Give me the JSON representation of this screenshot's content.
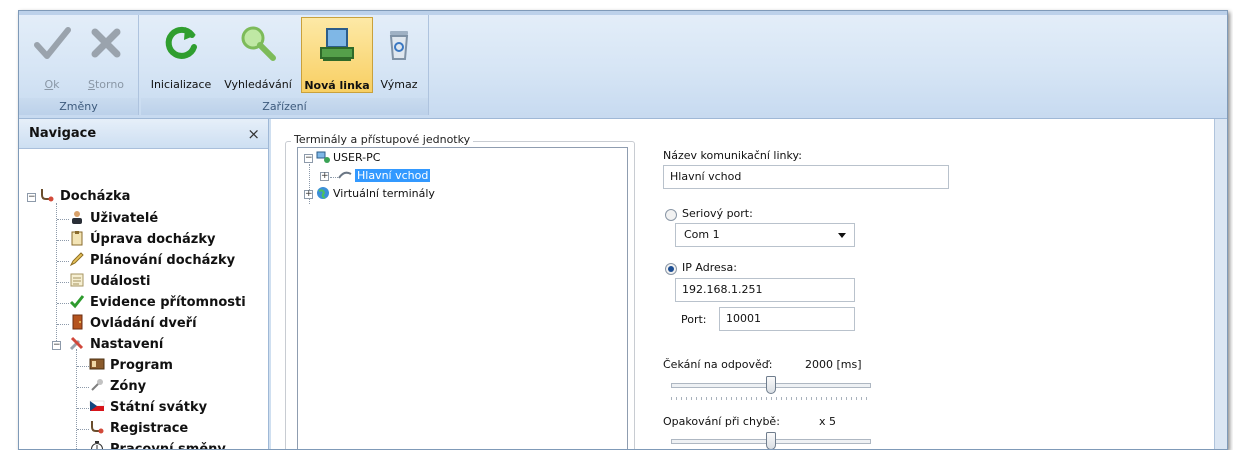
{
  "ribbon": {
    "groups": [
      {
        "caption": "Změny"
      },
      {
        "caption": "Zařízení"
      }
    ],
    "buttons": {
      "ok": {
        "prefix": "O",
        "rest": "k"
      },
      "storno": {
        "prefix": "S",
        "rest": "torno"
      },
      "inicializace": "Inicializace",
      "vyhledavani": "Vyhledávání",
      "nova_linka": "Nová linka",
      "vymaz": "Výmaz"
    }
  },
  "navigation": {
    "title": "Navigace",
    "close": "×",
    "items": [
      {
        "label": "Docházka"
      },
      {
        "label": "Uživatelé"
      },
      {
        "label": "Úprava docházky"
      },
      {
        "label": "Plánování docházky"
      },
      {
        "label": "Události"
      },
      {
        "label": "Evidence přítomnosti"
      },
      {
        "label": "Ovládání dveří"
      },
      {
        "label": "Nastavení"
      },
      {
        "label": "Program"
      },
      {
        "label": "Zóny"
      },
      {
        "label": "Státní svátky"
      },
      {
        "label": "Registrace"
      },
      {
        "label": "Pracovní směny"
      }
    ]
  },
  "terminals": {
    "legend": "Terminály a přístupové jednotky",
    "tree": [
      {
        "label": "USER-PC"
      },
      {
        "label": "Hlavní vchod"
      },
      {
        "label": "Virtuální terminály"
      }
    ]
  },
  "form": {
    "name_label": "Název komunikační linky:",
    "name_value": "Hlavní vchod",
    "serial_label": "Seriový port:",
    "serial_value": "Com 1",
    "ip_label": "IP Adresa:",
    "ip_value": "192.168.1.251",
    "port_label": "Port:",
    "port_value": "10001",
    "wait_label": "Čekání na odpověď:",
    "wait_value": "2000 [ms]",
    "wait_level": 0.5,
    "retry_label": "Opakování při chybě:",
    "retry_value": "x 5",
    "retry_level": 0.5,
    "connection_mode": "ip"
  }
}
